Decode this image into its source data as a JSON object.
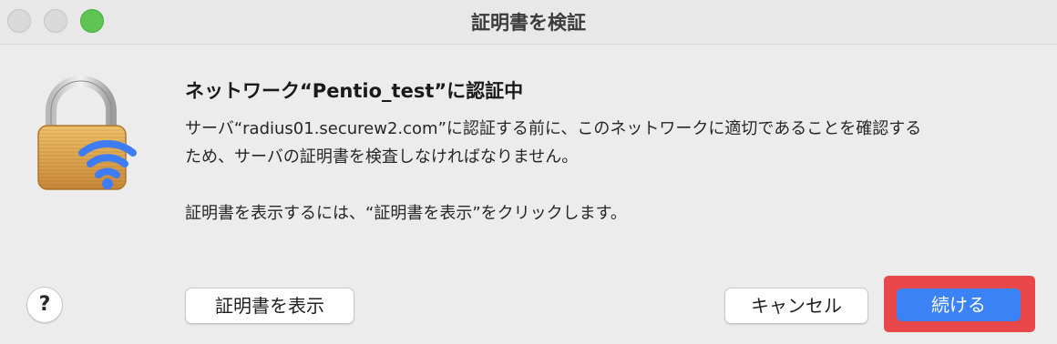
{
  "window": {
    "title": "証明書を検証"
  },
  "dialog": {
    "heading": "ネットワーク“Pentio_test”に認証中",
    "body_line1": "サーバ“radius01.securew2.com”に認証する前に、このネットワークに適切であることを確認する",
    "body_line2": "ため、サーバの証明書を検査しなければなりません。",
    "body_line3": "証明書を表示するには、“証明書を表示”をクリックします。",
    "icon": "lock-with-wifi-icon"
  },
  "buttons": {
    "help": "?",
    "show_certificate": "証明書を表示",
    "cancel": "キャンセル",
    "continue": "続ける"
  },
  "colors": {
    "accent_blue": "#3b82f6",
    "highlight_red": "#e8484a",
    "zoom_green": "#5ec453",
    "lock_gold": "#e0a94a",
    "wifi_blue": "#3d7cf5"
  }
}
